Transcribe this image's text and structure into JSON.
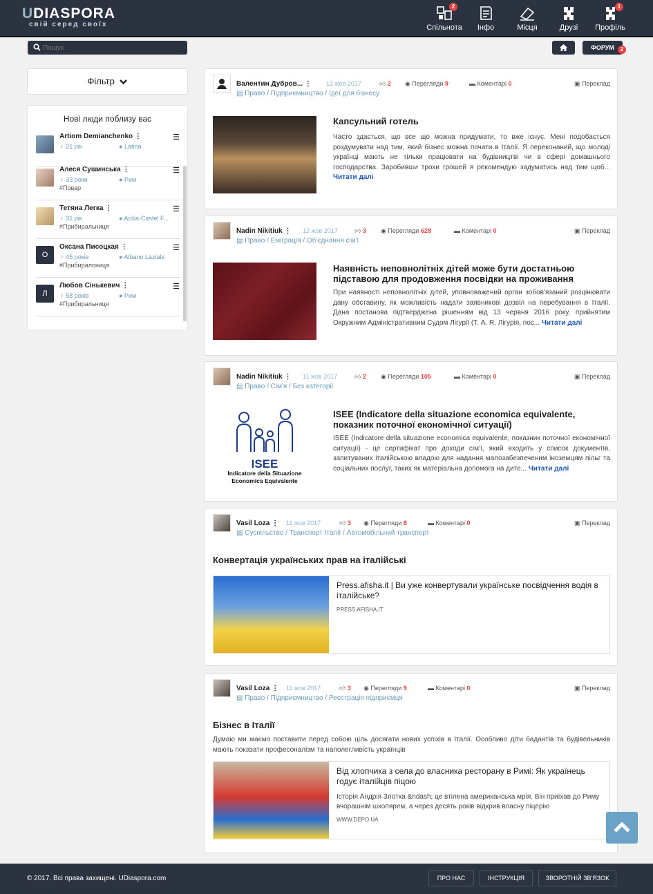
{
  "header": {
    "logo_prefix": "U",
    "logo_main": "DIASPORA",
    "logo_tagline": "свій серед своїх",
    "nav": [
      {
        "label": "Спільнота",
        "icon": "community-icon",
        "badge": "2"
      },
      {
        "label": "Інфо",
        "icon": "info-icon",
        "badge": ""
      },
      {
        "label": "Місця",
        "icon": "places-icon",
        "badge": ""
      },
      {
        "label": "Друзі",
        "icon": "friends-icon",
        "badge": ""
      },
      {
        "label": "Профіль",
        "icon": "profile-icon",
        "badge": "1"
      }
    ]
  },
  "search": {
    "placeholder": "Пошук"
  },
  "forum": {
    "label": "ФОРУМ",
    "badge": "2"
  },
  "filter": {
    "label": "Фільтр"
  },
  "people": {
    "title": "Нові люди поблизу вас",
    "items": [
      {
        "name": "Artiom Demianchenko",
        "age": "21 рік",
        "city": "Latina",
        "job": "",
        "avatar": ""
      },
      {
        "name": "Алеся Сушинська",
        "age": "33 роки",
        "city": "Рим",
        "job": "#Повар",
        "avatar": ""
      },
      {
        "name": "Тетяна Легка",
        "age": "31 рік",
        "city": "Acilia-Castel F...",
        "job": "#Прибиральниця",
        "avatar": ""
      },
      {
        "name": "Оксана Писоцкая",
        "age": "45 років",
        "city": "Albano Laziale",
        "job": "#Прибиралониця",
        "avatar": "О"
      },
      {
        "name": "Любов Сінькевич",
        "age": "58 років",
        "city": "Рим",
        "job": "#Прибиральниця",
        "avatar": "Л"
      }
    ]
  },
  "posts": [
    {
      "author": "Валентин Дубров...",
      "date": "12 жов 2017",
      "likes": "2",
      "views_label": "Перегляди",
      "views": "9",
      "comments_label": "Коментарі",
      "comments": "0",
      "translate": "Переклад",
      "cats": "Право / Підприємництво / Ідеї для бізнесу",
      "title": "Капсульний готель",
      "body": "Часто здається, що все що можна придумати, то вже існує. Мені подобається роздумувати над тим, який бізнес можна почати в Італії. Я переконаний, що молоді українці мають не тільки працювати на будівництві чи в сфері домашнього господарства. Заробивши трохи грошей я рекомендую задуматись над тим щоб...",
      "more": "Читати далі"
    },
    {
      "author": "Nadin Nikitiuk",
      "date": "12 жов 2017",
      "likes": "3",
      "views_label": "Перегляди",
      "views": "628",
      "comments_label": "Коментарі",
      "comments": "0",
      "translate": "Переклад",
      "cats": "Право / Еміграція / Об'єднання сім'ї",
      "title": "Наявність неповнолітніх дітей може бути достатньою підставою для продовження посвідки на проживання",
      "body": "При наявності неповнолітніх дітей, уповноважений орган зобов'язаний розцінювати дану обставину, як можливість надати заявникові дозвіл на перебування в Італії. Дана постанова підтверджена рішенням від 13 червня 2016 року, прийнятим Окружним Адміністративним Судом Лігурії (Т. А. R. Лігурія, пос...",
      "more": "Читати далі"
    },
    {
      "author": "Nadin Nikitiuk",
      "date": "11 жов 2017",
      "likes": "2",
      "views_label": "Перегляди",
      "views": "105",
      "comments_label": "Коментарі",
      "comments": "0",
      "translate": "Переклад",
      "cats": "Право / Сім'я / Без категорії",
      "title": "ISEE (Indicatore della situazione economica equivalente, показник поточної економічної ситуації)",
      "body": "ISEE (Indicatore della situazione economica equivalente, показник поточної економічної ситуації) - це сертифікат про доходи сім'ї, який входить у список документів, запитуваних італійською владою для надання малозабезпеченим іноземцям пільг та соціальних послуг, таких як матеріальна допомога на дите...",
      "more": "Читати далі",
      "image_text": [
        "ISEE",
        "Indicatore della Situazione",
        "Economica Equivalente"
      ]
    },
    {
      "author": "Vasil Loza",
      "date": "11 жов 2017",
      "likes": "3",
      "views_label": "Перегляди",
      "views": "8",
      "comments_label": "Коментарі",
      "comments": "0",
      "translate": "Переклад",
      "cats": "Суспільство / Транспорт Італії / Автомобільний транспорт",
      "title": "Конвертація українських прав на італійські",
      "link_title": "Press.afisha.it | Ви уже конвертували українське посвідчення водія в італійське?",
      "link_source": "PRESS.AFISHA.IT"
    },
    {
      "author": "Vasil Loza",
      "date": "11 жов 2017",
      "likes": "3",
      "views_label": "Перегляди",
      "views": "9",
      "comments_label": "Коментарі",
      "comments": "0",
      "translate": "Переклад",
      "cats": "Право / Підприємництво / Реєстрація підприємця",
      "title": "Бізнес в Італії",
      "body": "Думаю ми маємо поставити перед собою ціль досягати нових успіхів в Італії. Особливо діти бадантів та будівельників мають показати професоналізм та наполегливість українців",
      "link_title": "Від хлопчика з села до власника ресторану в Римі: Як українець годує італійців піцою",
      "link_desc": "Історія Андрія Злотка &ndash; це втілена американська мрія. Він приїхав до Риму вчорашнім школярем, а через десять років відкрив власну піцерію",
      "link_source": "WWW.DEPO.UA"
    }
  ],
  "footer": {
    "copyright": "© 2017. Всі права захищені. UDiaspora.com",
    "links": [
      "ПРО НАС",
      "ІНСТРУКЦІЯ",
      "ЗВОРОТНІЙ ЗВ'ЯЗОК"
    ]
  }
}
